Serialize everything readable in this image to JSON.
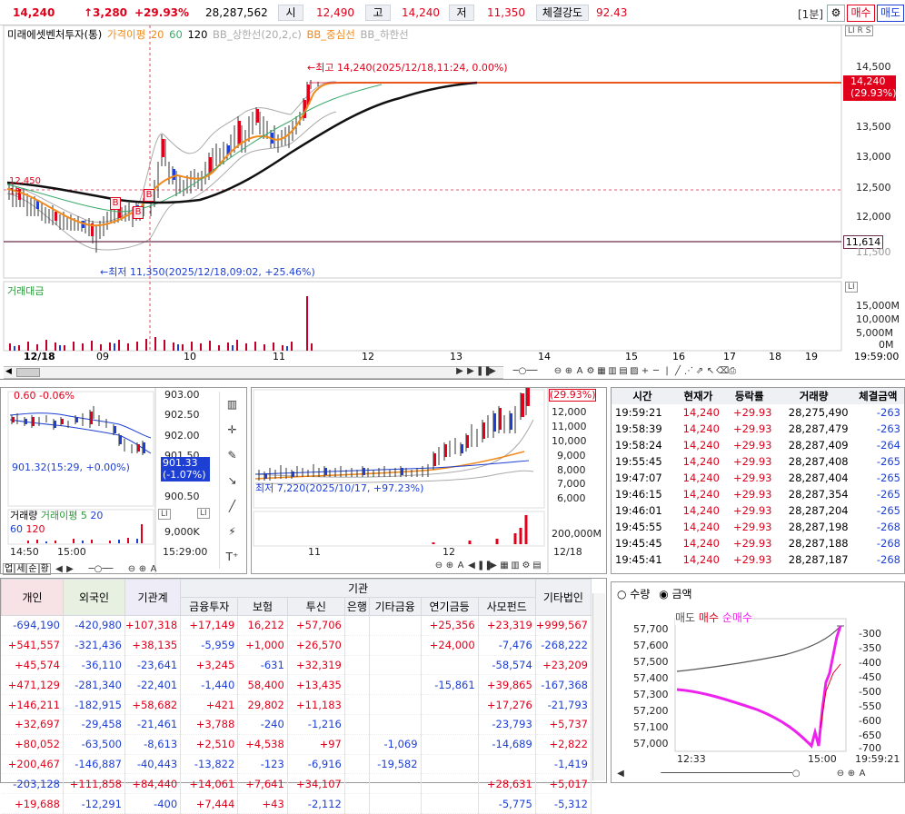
{
  "header": {
    "price": "14,240",
    "change": "↑3,280",
    "change_pct": "+29.93%",
    "volume": "28,287,562",
    "open_label": "시",
    "open": "12,490",
    "high_label": "고",
    "high": "14,240",
    "low_label": "저",
    "low": "11,350",
    "strength_label": "체결강도",
    "strength": "92.43",
    "interval": "[1분]",
    "sell_btn": "매수",
    "buy_btn": "매도"
  },
  "main_chart": {
    "legend": {
      "name": "미래에셋벤처투자(통)",
      "ma_label": "가격이평",
      "ma1": "20",
      "ma2": "60",
      "ma3": "120",
      "bb_upper": "BB_상한선(20,2,c)",
      "bb_mid": "BB_중심선",
      "bb_lower": "BB_하한선"
    },
    "high_annotation": "←최고 14,240(2025/12/18,11:24, 0.00%)",
    "low_annotation": "←최저 11,350(2025/12/18,09:02, +25.46%)",
    "price_tag": "14,240",
    "price_tag_pct": "(29.93%)",
    "level_tag": "11,614",
    "y_ticks": [
      "14,500",
      "13,500",
      "13,000",
      "12,500",
      "12,000",
      "11,500"
    ],
    "flags": [
      "LI",
      "R",
      "S"
    ],
    "vol_label": "거래대금",
    "vol_ticks": [
      "15,000M",
      "10,000M",
      "5,000M",
      "0M"
    ],
    "x_ticks": [
      "12/18",
      "09",
      "10",
      "11",
      "12",
      "13",
      "14",
      "15",
      "16",
      "17",
      "18",
      "19"
    ],
    "time": "19:59:00",
    "b_markers": [
      "B",
      "B",
      "B"
    ],
    "left_tags": [
      "12,450",
      "15"
    ]
  },
  "mini_chart": {
    "tag1": "0.60 -0.06%",
    "y_ticks": [
      "903.00",
      "902.50",
      "902.00",
      "901.50",
      "900.50"
    ],
    "value_tag": "901.33",
    "value_pct": "(-1.07%)",
    "annot": "901.32(15:29, +0.00%)",
    "vol_label": "거래량",
    "ma_label": "거래이평",
    "ma1": "5",
    "ma2": "20",
    "ma3": "60",
    "ma4": "120",
    "vol_tick": "9,000K",
    "x_ticks": [
      "14:50",
      "15:00",
      "15:29:00"
    ],
    "tabs": [
      "업",
      "세",
      "순",
      "황"
    ],
    "flags": [
      "LI",
      "LI"
    ]
  },
  "mid_chart": {
    "tag": "(29.93%)",
    "y_ticks": [
      "12,000",
      "11,000",
      "10,000",
      "9,000",
      "8,000",
      "7,000",
      "6,000"
    ],
    "annot": "최저 7,220(2025/10/17, +97.23%)",
    "vol_tick": "200,000M",
    "x_ticks": [
      "11",
      "12",
      "12/18"
    ]
  },
  "trades": {
    "headers": [
      "시간",
      "현재가",
      "등락률",
      "거래량",
      "체결금액"
    ],
    "rows": [
      [
        "19:59:21",
        "14,240",
        "+29.93",
        "28,275,490",
        "-263"
      ],
      [
        "19:58:39",
        "14,240",
        "+29.93",
        "28,287,479",
        "-263"
      ],
      [
        "19:58:24",
        "14,240",
        "+29.93",
        "28,287,409",
        "-264"
      ],
      [
        "19:55:45",
        "14,240",
        "+29.93",
        "28,287,408",
        "-265"
      ],
      [
        "19:47:07",
        "14,240",
        "+29.93",
        "28,287,404",
        "-265"
      ],
      [
        "19:46:15",
        "14,240",
        "+29.93",
        "28,287,354",
        "-265"
      ],
      [
        "19:46:01",
        "14,240",
        "+29.93",
        "28,287,204",
        "-265"
      ],
      [
        "19:45:55",
        "14,240",
        "+29.93",
        "28,287,198",
        "-268"
      ],
      [
        "19:45:45",
        "14,240",
        "+29.93",
        "28,287,188",
        "-268"
      ],
      [
        "19:45:41",
        "14,240",
        "+29.93",
        "28,287,187",
        "-268"
      ]
    ]
  },
  "institutions": {
    "group_label": "기관",
    "headers": [
      "개인",
      "외국인",
      "기관계",
      "금융투자",
      "보험",
      "투신",
      "은행",
      "기타금융",
      "연기금등",
      "사모펀드",
      "기타법인"
    ],
    "rows": [
      [
        "-694,190",
        "-420,980",
        "+107,318",
        "+17,149",
        "16,212",
        "+57,706",
        "",
        "",
        "+25,356",
        "+23,319",
        "+999,567"
      ],
      [
        "+541,557",
        "-321,436",
        "+38,135",
        "-5,959",
        "+1,000",
        "+26,570",
        "",
        "",
        "+24,000",
        "-7,476",
        "-268,222"
      ],
      [
        "+45,574",
        "-36,110",
        "-23,641",
        "+3,245",
        "-631",
        "+32,319",
        "",
        "",
        "",
        "-58,574",
        "+23,209"
      ],
      [
        "+471,129",
        "-281,340",
        "-22,401",
        "-1,440",
        "58,400",
        "+13,435",
        "",
        "",
        "-15,861",
        "+39,865",
        "-167,368"
      ],
      [
        "+146,211",
        "-182,915",
        "+58,682",
        "+421",
        "29,802",
        "+11,183",
        "",
        "",
        "",
        "+17,276",
        "-21,793"
      ],
      [
        "+32,697",
        "-29,458",
        "-21,461",
        "+3,788",
        "-240",
        "-1,216",
        "",
        "",
        "",
        "-23,793",
        "+5,737"
      ],
      [
        "+80,052",
        "-63,500",
        "-8,613",
        "+2,510",
        "+4,538",
        "+97",
        "",
        "-1,069",
        "",
        "-14,689",
        "+2,822"
      ],
      [
        "+200,467",
        "-146,887",
        "-40,443",
        "-13,822",
        "-123",
        "-6,916",
        "",
        "-19,582",
        "",
        "",
        "-1,419"
      ],
      [
        "-203,128",
        "+111,858",
        "+84,440",
        "+14,061",
        "+7,641",
        "+34,107",
        "",
        "",
        "",
        "+28,631",
        "+5,017"
      ],
      [
        "+19,688",
        "-12,291",
        "-400",
        "+7,444",
        "+43",
        "-2,112",
        "",
        "",
        "",
        "-5,775",
        "-5,312"
      ]
    ]
  },
  "flow": {
    "radio1": "수량",
    "radio2": "금액",
    "legend_sell": "매도",
    "legend_buy": "매수",
    "legend_net": "순매수",
    "y_left": [
      "57,700",
      "57,600",
      "57,500",
      "57,400",
      "57,300",
      "57,200",
      "57,100",
      "57,000"
    ],
    "y_right": [
      "-300",
      "-350",
      "-400",
      "-450",
      "-500",
      "-550",
      "-600",
      "-650",
      "-700"
    ],
    "x_ticks": [
      "12:33",
      "15:00",
      "19:59:21"
    ]
  }
}
